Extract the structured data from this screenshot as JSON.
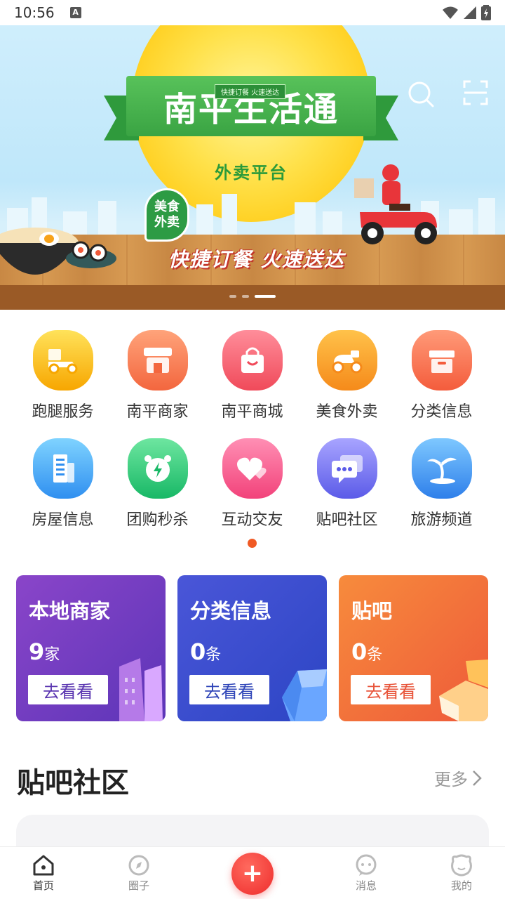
{
  "status_bar": {
    "time": "10:56",
    "notification_badge": "A",
    "icons": [
      "wifi-icon",
      "signal-icon",
      "battery-icon"
    ]
  },
  "banner": {
    "title": "南平生活通",
    "tagline_top": "快捷订餐  火速送达",
    "subtitle": "外卖平台",
    "badge": "美食外卖",
    "slogan": "快捷订餐  火速送达",
    "active_slide": 3,
    "slide_count": 3
  },
  "grid": {
    "items": [
      {
        "label": "跑腿服务",
        "icon": "scooter-icon",
        "color_from": "#ffe25a",
        "color_to": "#f7a600"
      },
      {
        "label": "南平商家",
        "icon": "store-icon",
        "color_from": "#ffa37a",
        "color_to": "#f3663e"
      },
      {
        "label": "南平商城",
        "icon": "shopping-bag-icon",
        "color_from": "#ff8d9a",
        "color_to": "#f04a5a"
      },
      {
        "label": "美食外卖",
        "icon": "delivery-scooter-icon",
        "color_from": "#ffc24a",
        "color_to": "#f58a1a"
      },
      {
        "label": "分类信息",
        "icon": "box-icon",
        "color_from": "#ff9a78",
        "color_to": "#f45c3c"
      },
      {
        "label": "房屋信息",
        "icon": "building-icon",
        "color_from": "#7fd3ff",
        "color_to": "#2f8ff0"
      },
      {
        "label": "团购秒杀",
        "icon": "alarm-clock-icon",
        "color_from": "#6ee6a0",
        "color_to": "#18b866"
      },
      {
        "label": "互动交友",
        "icon": "hearts-icon",
        "color_from": "#ff8fb4",
        "color_to": "#f2427a"
      },
      {
        "label": "贴吧社区",
        "icon": "chat-bubbles-icon",
        "color_from": "#a8a4ff",
        "color_to": "#5b5be8"
      },
      {
        "label": "旅游频道",
        "icon": "palm-tree-icon",
        "color_from": "#7ec8ff",
        "color_to": "#2e7fea"
      }
    ]
  },
  "cards": [
    {
      "title": "本地商家",
      "count": "9",
      "unit": "家",
      "button": "去看看",
      "color_from": "#8a45c9",
      "color_to": "#5c35b8",
      "button_color": "#5a35b0"
    },
    {
      "title": "分类信息",
      "count": "0",
      "unit": "条",
      "button": "去看看",
      "color_from": "#4a56d8",
      "color_to": "#2c45c4",
      "button_color": "#2f45b8"
    },
    {
      "title": "贴吧",
      "count": "0",
      "unit": "条",
      "button": "去看看",
      "color_from": "#f78b3c",
      "color_to": "#ee5a3a",
      "button_color": "#e8543a"
    }
  ],
  "section": {
    "title": "贴吧社区",
    "more": "更多"
  },
  "bottom_nav": {
    "items": [
      {
        "label": "首页",
        "active": true
      },
      {
        "label": "圈子",
        "active": false
      },
      {
        "label": "消息",
        "active": false
      },
      {
        "label": "我的",
        "active": false
      }
    ],
    "fab": "+"
  }
}
